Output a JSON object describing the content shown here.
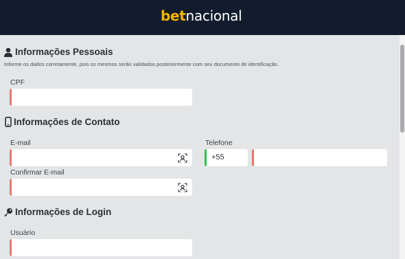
{
  "brand": {
    "part1": "bet",
    "part2": "nacional"
  },
  "colors": {
    "header": "#131c2e",
    "accent": "#f5b400",
    "error": "#e8766d",
    "ok": "#2fbf4f"
  },
  "personal": {
    "title": "Informações Pessoais",
    "icon": "user-icon",
    "description": "Informe os dados corretamente, pois os mesmos serão validados posteriormente com seu documento de identificação.",
    "cpf_label": "CPF",
    "cpf_value": ""
  },
  "contact": {
    "title": "Informações de Contato",
    "icon": "mobile-phone-icon",
    "email_label": "E-mail",
    "email_value": "",
    "confirm_email_label": "Confirmar E-mail",
    "confirm_email_value": "",
    "phone_label": "Telefone",
    "phone_code": "+55",
    "phone_value": "",
    "autofill_icon": "face-scan-icon"
  },
  "login": {
    "title": "Informações de Login",
    "icon": "key-icon",
    "username_label": "Usuário",
    "username_value": ""
  }
}
